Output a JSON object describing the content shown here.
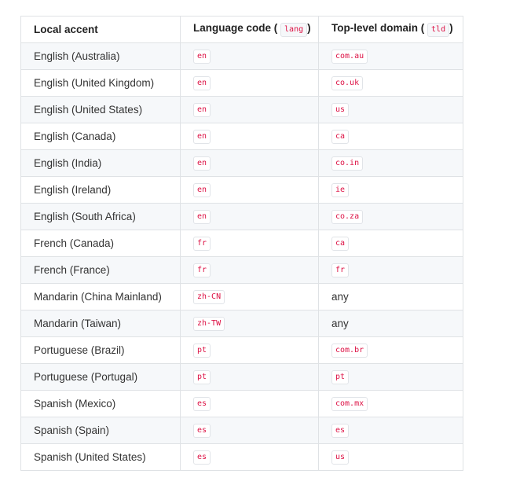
{
  "table": {
    "headers": {
      "accent": "Local accent",
      "lang_prefix": "Language code (",
      "lang_code": "lang",
      "lang_suffix": ")",
      "tld_prefix": "Top-level domain (",
      "tld_code": "tld",
      "tld_suffix": ")"
    },
    "rows": [
      {
        "accent": "English (Australia)",
        "lang": "en",
        "tld": "com.au",
        "tld_is_code": true
      },
      {
        "accent": "English (United Kingdom)",
        "lang": "en",
        "tld": "co.uk",
        "tld_is_code": true
      },
      {
        "accent": "English (United States)",
        "lang": "en",
        "tld": "us",
        "tld_is_code": true
      },
      {
        "accent": "English (Canada)",
        "lang": "en",
        "tld": "ca",
        "tld_is_code": true
      },
      {
        "accent": "English (India)",
        "lang": "en",
        "tld": "co.in",
        "tld_is_code": true
      },
      {
        "accent": "English (Ireland)",
        "lang": "en",
        "tld": "ie",
        "tld_is_code": true
      },
      {
        "accent": "English (South Africa)",
        "lang": "en",
        "tld": "co.za",
        "tld_is_code": true
      },
      {
        "accent": "French (Canada)",
        "lang": "fr",
        "tld": "ca",
        "tld_is_code": true
      },
      {
        "accent": "French (France)",
        "lang": "fr",
        "tld": "fr",
        "tld_is_code": true
      },
      {
        "accent": "Mandarin (China Mainland)",
        "lang": "zh-CN",
        "tld": "any",
        "tld_is_code": false
      },
      {
        "accent": "Mandarin (Taiwan)",
        "lang": "zh-TW",
        "tld": "any",
        "tld_is_code": false
      },
      {
        "accent": "Portuguese (Brazil)",
        "lang": "pt",
        "tld": "com.br",
        "tld_is_code": true
      },
      {
        "accent": "Portuguese (Portugal)",
        "lang": "pt",
        "tld": "pt",
        "tld_is_code": true
      },
      {
        "accent": "Spanish (Mexico)",
        "lang": "es",
        "tld": "com.mx",
        "tld_is_code": true
      },
      {
        "accent": "Spanish (Spain)",
        "lang": "es",
        "tld": "es",
        "tld_is_code": true
      },
      {
        "accent": "Spanish (United States)",
        "lang": "es",
        "tld": "us",
        "tld_is_code": true
      }
    ]
  },
  "colors": {
    "code_text": "#dd1144",
    "border": "#dfe2e5",
    "stripe": "#f6f8fa"
  }
}
